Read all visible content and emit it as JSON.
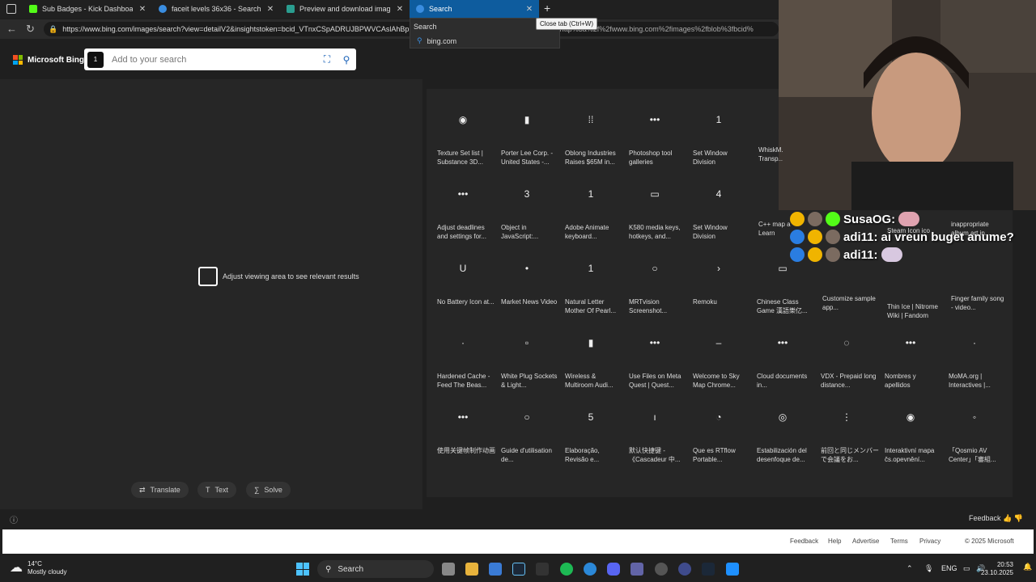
{
  "browser": {
    "tabs": [
      {
        "title": "Sub Badges - Kick Dashboard",
        "color": "#53fc18"
      },
      {
        "title": "faceit levels 36x36 - Search",
        "color": "#3a8de0"
      },
      {
        "title": "Preview and download image - R",
        "color": "#2a9d8f"
      },
      {
        "title": "Search",
        "color": "#3a8de0"
      }
    ],
    "new_tab": "+",
    "tooltip": "Close tab (Ctrl+W)",
    "url": "https://www.bing.com/images/search?view=detailV2&insightstoken=bcid_VTnxCSpADRUJBPWVCAslAhBp",
    "url_tail": "ing-+http%3a%2f%2fwww.bing.com%2fimages%2fblob%3fbcid%",
    "dropdown_title": "Search",
    "dropdown_item": "bing.com"
  },
  "bing": {
    "logo": "Microsoft Bing",
    "search_placeholder": "Add to your search",
    "search_thumb": "1",
    "adjust_text": "Adjust viewing area to see relevant results",
    "tools": [
      "Translate",
      "Text",
      "Solve"
    ]
  },
  "results": [
    {
      "cap": "Texture Set list | Substance 3D...",
      "glyph": "◉"
    },
    {
      "cap": "Porter Lee Corp. - United States -...",
      "glyph": "▮"
    },
    {
      "cap": "Oblong Industries Raises $65M in...",
      "glyph": "⁞⁞"
    },
    {
      "cap": "Photoshop tool galleries",
      "glyph": "•••"
    },
    {
      "cap": "Set Window Division",
      "glyph": "1"
    },
    {
      "cap": "Adjust deadlines and settings for...",
      "glyph": "•••"
    },
    {
      "cap": "Object in JavaScript:...",
      "glyph": "3"
    },
    {
      "cap": "Adobe Animate keyboard...",
      "glyph": "1"
    },
    {
      "cap": "K580 media keys, hotkeys, and...",
      "glyph": "▭"
    },
    {
      "cap": "Set Window Division",
      "glyph": "4"
    },
    {
      "cap": "No Battery Icon at...",
      "glyph": "U"
    },
    {
      "cap": "Market News Video",
      "glyph": "•"
    },
    {
      "cap": "Natural Letter Mother Of Pearl...",
      "glyph": "1"
    },
    {
      "cap": "MRTvision Screenshot...",
      "glyph": "○"
    },
    {
      "cap": "Remoku",
      "glyph": "›"
    },
    {
      "cap": "Chinese Class Game 漢語樂亿...",
      "glyph": "▭"
    },
    {
      "cap": "Hardened Cache - Feed The Beas...",
      "glyph": "·"
    },
    {
      "cap": "White Plug Sockets & Light...",
      "glyph": "▫"
    },
    {
      "cap": "Wireless & Multiroom Audi...",
      "glyph": "▮"
    },
    {
      "cap": "Use Files on Meta Quest | Quest...",
      "glyph": "•••"
    },
    {
      "cap": "Welcome to Sky Map Chrome...",
      "glyph": "–"
    },
    {
      "cap": "Cloud documents in...",
      "glyph": "•••"
    },
    {
      "cap": "VDX - Prepaid long distance...",
      "glyph": "◌"
    },
    {
      "cap": "Nombres y apellidos",
      "glyph": "•••"
    },
    {
      "cap": "MoMA.org | Interactives |...",
      "glyph": "·"
    },
    {
      "cap": "使用关键帧制作动画",
      "glyph": "•••"
    },
    {
      "cap": "Guide d'utilisation de...",
      "glyph": "○"
    },
    {
      "cap": "Elaboração, Revisão e...",
      "glyph": "5"
    },
    {
      "cap": "默认快捷键 - 《Cascadeur 中...",
      "glyph": "ı"
    },
    {
      "cap": "Que es RTflow Portable...",
      "glyph": "◔"
    },
    {
      "cap": "Estabilización del desenfoque de...",
      "glyph": "◎"
    },
    {
      "cap": "前回と同じメンバーで会議をお...",
      "glyph": "⋮"
    },
    {
      "cap": "Interaktivní mapa čs.opevnění...",
      "glyph": "◉"
    },
    {
      "cap": "「Qosmio AV Center」「審組...",
      "glyph": "◦"
    }
  ],
  "footer": {
    "feedback": "Feedback",
    "links": [
      "Feedback",
      "Help",
      "Advertise",
      "Terms",
      "Privacy",
      "© 2025 Microsoft"
    ]
  },
  "taskbar": {
    "temp": "14°C",
    "weather": "Mostly cloudy",
    "search": "Search",
    "lang": "ENG",
    "time": "20:53",
    "date": "23.10.2025"
  },
  "chat": {
    "line1_user": "SusaOG:",
    "line2_user": "adi11:",
    "line2_msg": "ai vreun buget anume?",
    "line3_user": "adi11:"
  },
  "partial_caps": {
    "c1": "WhiskM... Transp...",
    "c2": "C++ map a Learn the...",
    "c3": "Customize sample app...",
    "c4": "Steam Icon ico",
    "c5": "inappropriate album art in...",
    "c6": "Thin Ice | Nitrome Wiki | Fandom",
    "c7": "Finger family song - video..."
  }
}
